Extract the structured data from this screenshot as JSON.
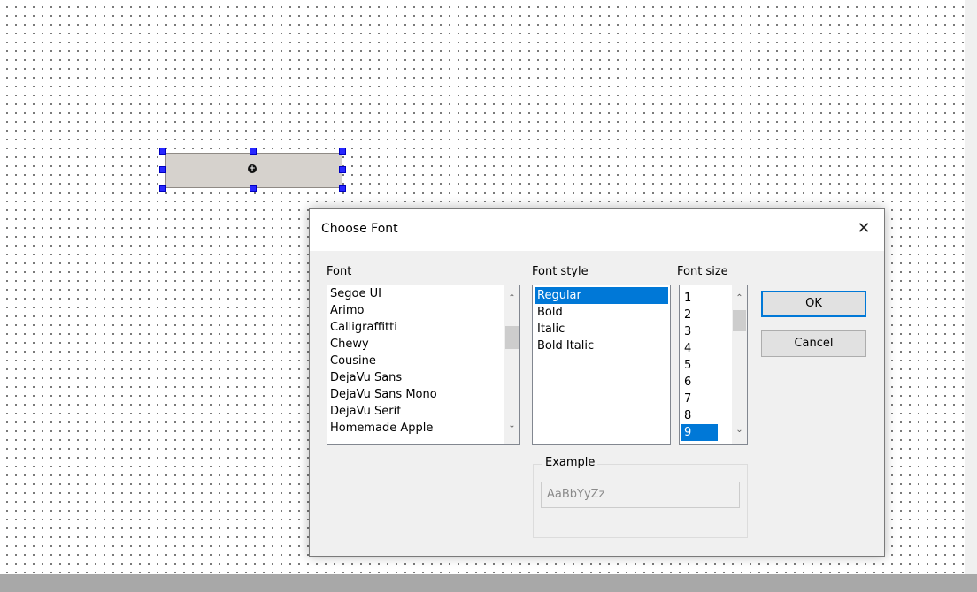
{
  "dialog": {
    "title": "Choose Font",
    "close_icon": "close-icon"
  },
  "font": {
    "label": "Font",
    "items": [
      "Segoe UI",
      "Arimo",
      "Calligraffitti",
      "Chewy",
      "Cousine",
      "DejaVu Sans",
      "DejaVu Sans Mono",
      "DejaVu Serif",
      "Homemade Apple"
    ]
  },
  "style": {
    "label": "Font style",
    "items": [
      "Regular",
      "Bold",
      "Italic",
      "Bold Italic"
    ],
    "selected": "Regular"
  },
  "size": {
    "label": "Font size",
    "items": [
      "1",
      "2",
      "3",
      "4",
      "5",
      "6",
      "7",
      "8",
      "9"
    ],
    "selected": "9"
  },
  "buttons": {
    "ok": "OK",
    "cancel": "Cancel"
  },
  "example": {
    "label": "Example",
    "text": "AaBbYyZz"
  },
  "colors": {
    "selection": "#0078d7",
    "handle": "#2727ff",
    "widget": "#d6d2cd"
  }
}
